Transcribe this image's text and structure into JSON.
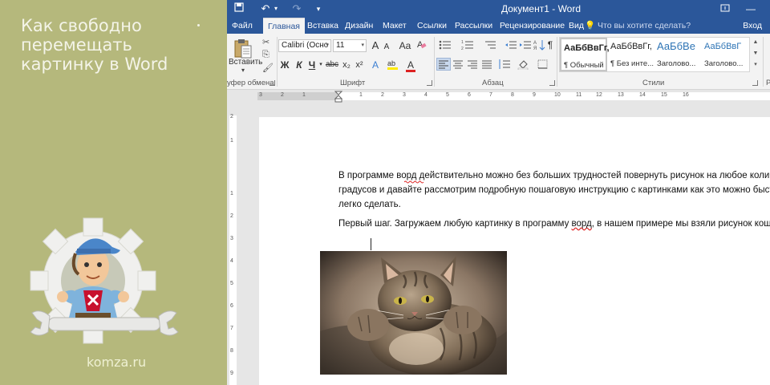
{
  "promo": {
    "title": "Как свободно перемещать картинку в Word",
    "site": "komza.ru"
  },
  "titlebar": {
    "doc_title": "Документ1 - Word",
    "qat": [
      "save-icon",
      "undo-icon",
      "redo-icon",
      "customize-icon"
    ]
  },
  "tabs": [
    "Файл",
    "Главная",
    "Вставка",
    "Дизайн",
    "Макет",
    "Ссылки",
    "Рассылки",
    "Рецензирование",
    "Вид"
  ],
  "tell_me": "Что вы хотите сделать?",
  "sign_in": "Вход",
  "ribbon": {
    "clipboard": {
      "paste_label": "Вставить",
      "group_label": "уфер обмена"
    },
    "font": {
      "font_name": "Calibri (Осно",
      "font_size": "11",
      "bold": "Ж",
      "italic": "К",
      "underline": "Ч",
      "strike": "abc",
      "subscript": "x₂",
      "superscript": "x²",
      "grow": "A",
      "shrink": "A",
      "case": "Aa",
      "text_effects": "A",
      "font_color": "A",
      "group_label": "Шрифт"
    },
    "paragraph": {
      "group_label": "Абзац",
      "pilcrow": "¶"
    },
    "styles": {
      "group_label": "Стили",
      "items": [
        {
          "preview": "АаБбВвГг,",
          "name": "¶ Обычный"
        },
        {
          "preview": "АаБбВвГг,",
          "name": "¶ Без инте..."
        },
        {
          "preview": "АаБбВе",
          "name": "Заголово..."
        },
        {
          "preview": "АаБбВвГ",
          "name": "Заголово..."
        }
      ]
    },
    "edit_label": "Р"
  },
  "ruler": {
    "top_numbers": [
      "3",
      "2",
      "1",
      "1",
      "2",
      "3",
      "4",
      "5",
      "6",
      "7",
      "8",
      "9",
      "10",
      "11",
      "12",
      "13",
      "14",
      "15",
      "16"
    ],
    "side_numbers": [
      "2",
      "1",
      "1",
      "2",
      "3",
      "4",
      "5",
      "6",
      "7",
      "8",
      "9"
    ]
  },
  "document": {
    "p1_line1": "В программе ворд действительно можно без больших трудностей повернуть рисунок на любое количество",
    "p1_line2": "градусов и давайте рассмотрим подробную пошаговую инструкцию с картинками как это можно быстро",
    "p1_line3": "легко сделать.",
    "p2_before": "Первый шаг. Загружаем любую картинку в программу ",
    "p2_word1": "ворд",
    "p2_after": ", в нашем примере мы взяли рисунок кошки.",
    "p1_misspelled": "ворд"
  },
  "colors": {
    "word_blue": "#2b579a",
    "promo_bg": "#b5b87c",
    "ribbon_bg": "#f3f3f3",
    "canvas_bg": "#e6e6e6"
  }
}
